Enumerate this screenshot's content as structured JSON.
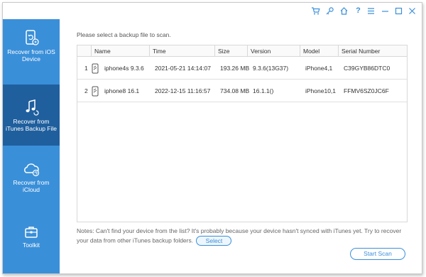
{
  "titlebar": {
    "icons": [
      "cart-icon",
      "key-icon",
      "home-icon",
      "help-icon",
      "menu-icon",
      "minimize-icon",
      "maximize-icon",
      "close-icon"
    ],
    "glyphs": {
      "help": "?"
    }
  },
  "sidebar": {
    "items": [
      {
        "label_line1": "Recover from iOS",
        "label_line2": "Device",
        "icon": "ios-device-icon"
      },
      {
        "label_line1": "Recover from",
        "label_line2": "iTunes Backup File",
        "icon": "itunes-icon",
        "active": true
      },
      {
        "label_line1": "Recover from",
        "label_line2": "iCloud",
        "icon": "icloud-icon"
      },
      {
        "label_line1": "Toolkit",
        "label_line2": "",
        "icon": "toolkit-icon"
      }
    ]
  },
  "main": {
    "prompt": "Please select a backup file to scan.",
    "table": {
      "headers": [
        "Name",
        "Time",
        "Size",
        "Version",
        "Model",
        "Serial Number"
      ],
      "rows": [
        {
          "index": "1",
          "name": "iphone4s 9.3.6",
          "time": "2021-05-21 14:14:07",
          "size": "193.26 MB",
          "version": "9.3.6(13G37)",
          "model": "iPhone4,1",
          "serial": "C39GYB86DTC0"
        },
        {
          "index": "2",
          "name": "iphone8 16.1",
          "time": "2022-12-15 11:16:57",
          "size": "734.08 MB",
          "version": "16.1.1()",
          "model": "iPhone10,1",
          "serial": "FFMV6SZ0JC6F"
        }
      ]
    },
    "notes_line1": "Notes: Can't find your device from the list? It's probably because your device hasn't synced with iTunes yet. Try to recover",
    "notes_line2": "your data from other iTunes backup folders.",
    "select_label": "Select",
    "start_scan_label": "Start Scan"
  },
  "colors": {
    "accent": "#3a8fd9",
    "sidebar_active": "#1f5f9e"
  }
}
